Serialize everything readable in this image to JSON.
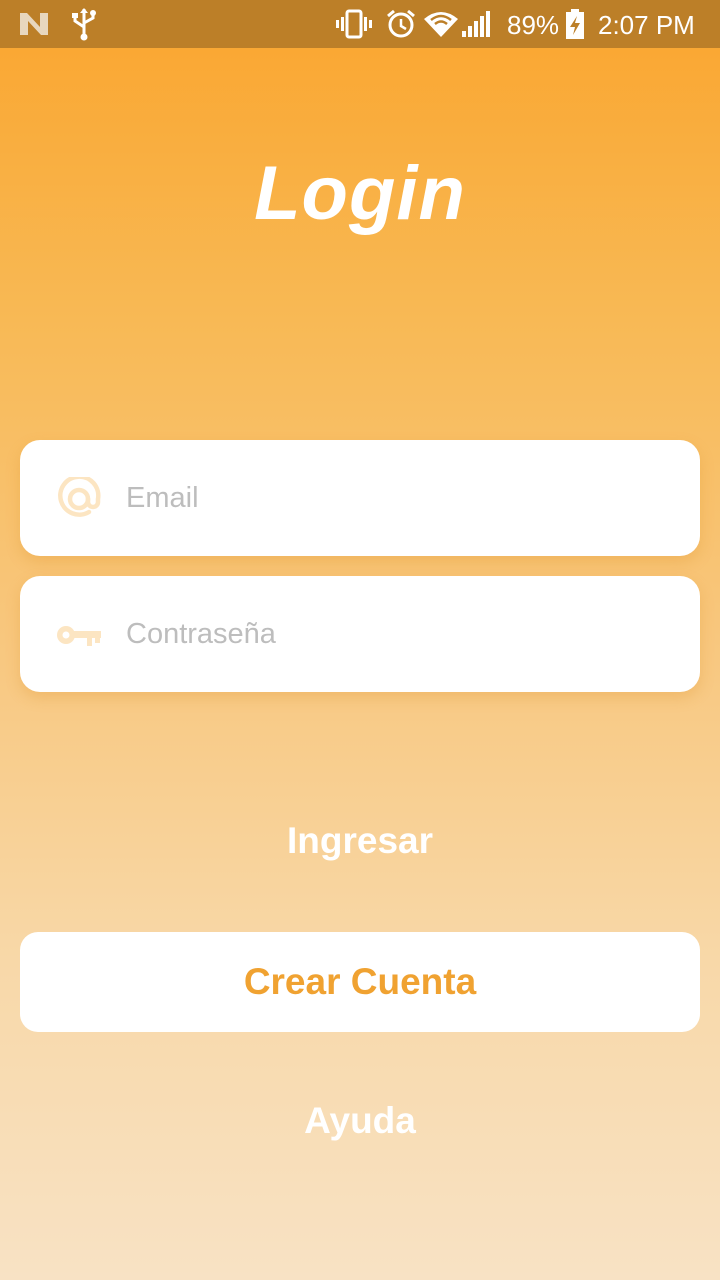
{
  "status_bar": {
    "battery_percent": "89%",
    "time": "2:07 PM",
    "icons": [
      "n-logo-icon",
      "usb-icon",
      "vibrate-icon",
      "alarm-icon",
      "wifi-icon",
      "signal-icon",
      "battery-charging-icon"
    ]
  },
  "title": "Login",
  "form": {
    "email": {
      "placeholder": "Email",
      "value": "",
      "icon": "at-icon"
    },
    "password": {
      "placeholder": "Contraseña",
      "value": "",
      "icon": "key-icon"
    }
  },
  "actions": {
    "login_label": "Ingresar",
    "create_account_label": "Crear Cuenta",
    "help_label": "Ayuda"
  },
  "colors": {
    "status_bar": "#BC7F28",
    "gradient_top": "#FAA52E",
    "gradient_bottom": "#F8E2C4",
    "accent": "#F0A231",
    "icon_tint": "#FCE5C2",
    "placeholder": "#BDBDBD"
  }
}
